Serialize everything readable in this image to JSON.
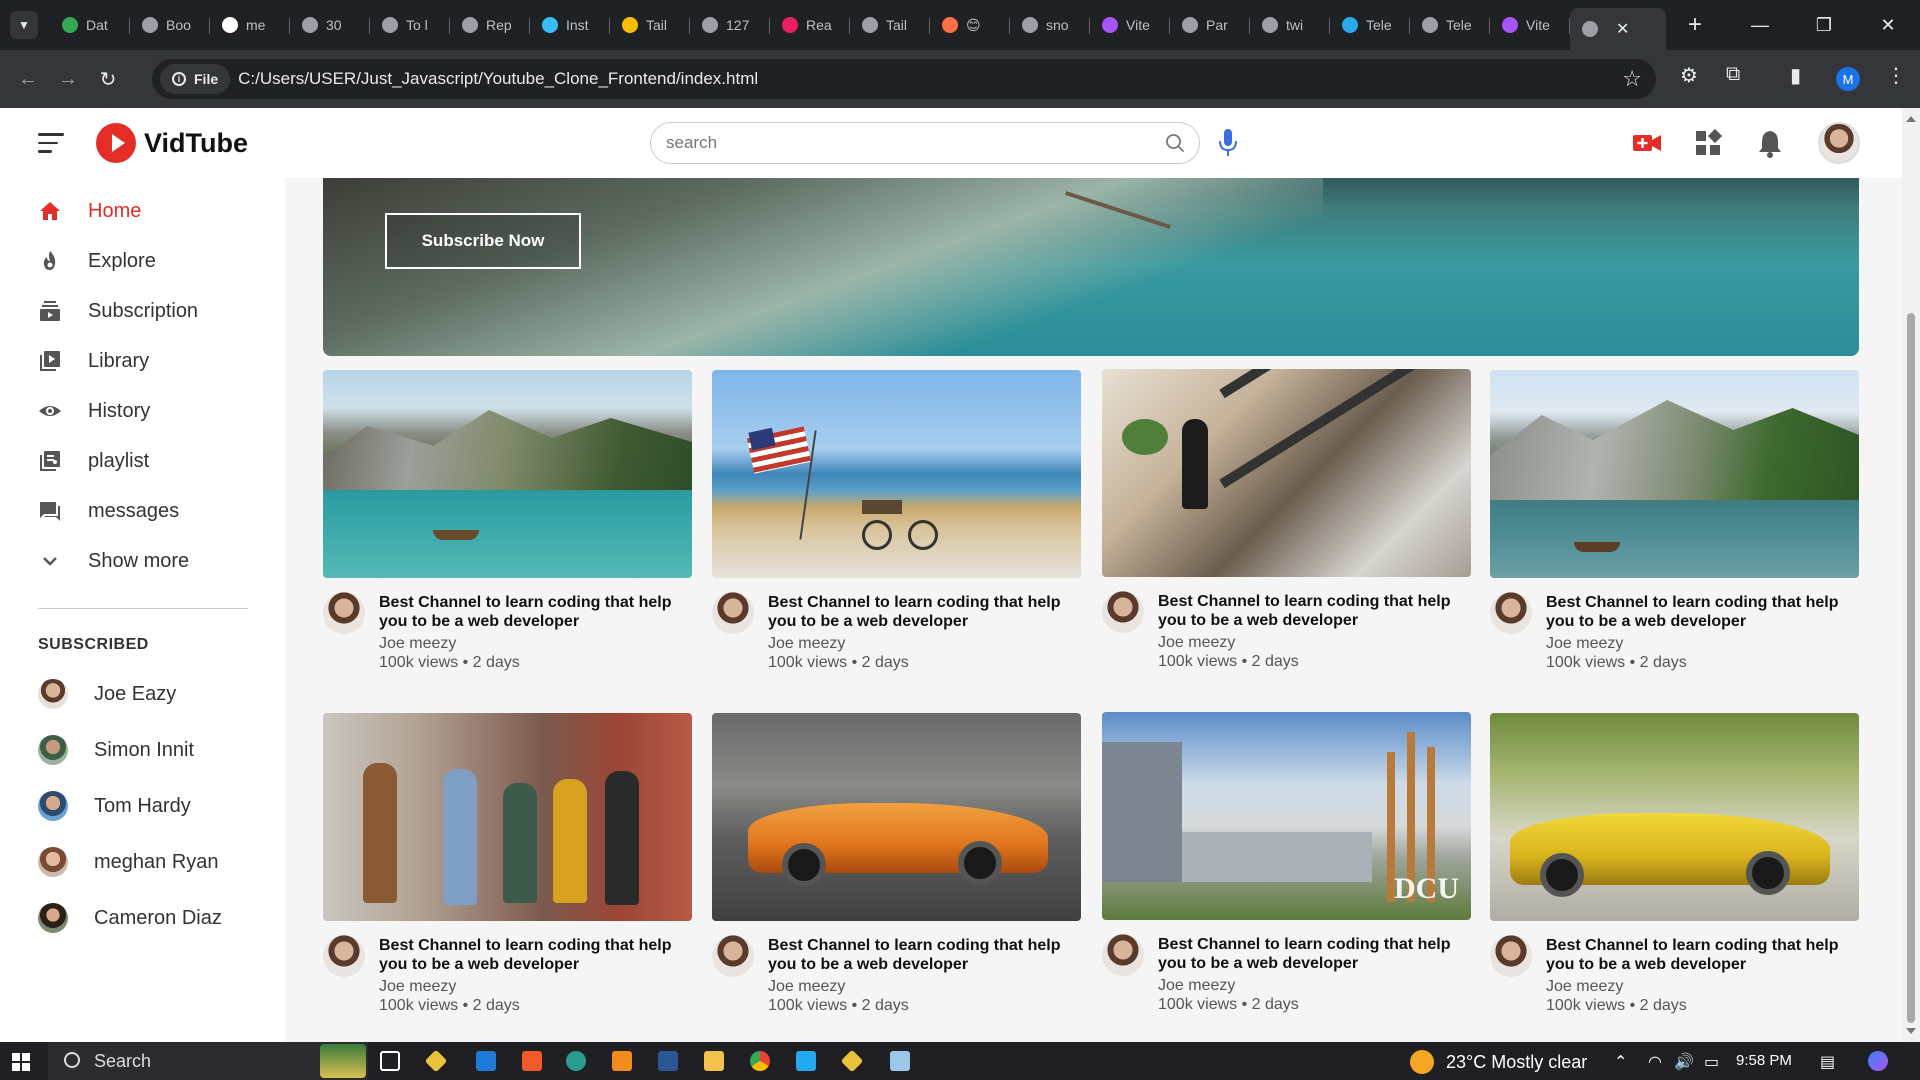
{
  "browser": {
    "tabs": [
      {
        "title": "Dat",
        "color": "#34a853"
      },
      {
        "title": "Boo",
        "color": "#9aa0a6"
      },
      {
        "title": "me",
        "color": "#ffffff"
      },
      {
        "title": "30",
        "color": "#9aa0a6"
      },
      {
        "title": "To l",
        "color": "#9aa0a6"
      },
      {
        "title": "Rep",
        "color": "#9aa0a6"
      },
      {
        "title": "Inst",
        "color": "#38bdf8"
      },
      {
        "title": "Tail",
        "color": "#fbbc04"
      },
      {
        "title": "127",
        "color": "#9aa0a6"
      },
      {
        "title": "Rea",
        "color": "#e91e63"
      },
      {
        "title": "Tail",
        "color": "#9aa0a6"
      },
      {
        "title": "😊",
        "color": "#ff7043"
      },
      {
        "title": "sno",
        "color": "#9aa0a6"
      },
      {
        "title": "Vite",
        "color": "#a855f7"
      },
      {
        "title": "Par",
        "color": "#9aa0a6"
      },
      {
        "title": "twi",
        "color": "#9aa0a6"
      },
      {
        "title": "Tele",
        "color": "#29a9ea"
      },
      {
        "title": "Tele",
        "color": "#9aa0a6"
      },
      {
        "title": "Vite",
        "color": "#a855f7"
      }
    ],
    "active_tab_icon": "globe-icon",
    "site_chip": "File",
    "url": "C:/Users/USER/Just_Javascript/Youtube_Clone_Frontend/index.html",
    "profile_initial": "M"
  },
  "header": {
    "logo_text": "VidTube",
    "search_placeholder": "search",
    "icons": [
      "menu-icon",
      "search-icon",
      "mic-icon",
      "video-camera-icon",
      "apps-icon",
      "bell-icon",
      "avatar"
    ]
  },
  "sidebar": {
    "nav": [
      {
        "label": "Home",
        "icon": "home-icon",
        "active": true
      },
      {
        "label": "Explore",
        "icon": "fire-icon",
        "active": false
      },
      {
        "label": "Subscription",
        "icon": "subscription-icon",
        "active": false
      },
      {
        "label": "Library",
        "icon": "library-icon",
        "active": false
      },
      {
        "label": "History",
        "icon": "eye-icon",
        "active": false
      },
      {
        "label": "playlist",
        "icon": "playlist-icon",
        "active": false
      },
      {
        "label": "messages",
        "icon": "messages-icon",
        "active": false
      },
      {
        "label": "Show more",
        "icon": "chevron-down-icon",
        "active": false
      }
    ],
    "subscribed_heading": "SUBSCRIBED",
    "subscribed": [
      {
        "name": "Joe Eazy"
      },
      {
        "name": "Simon Innit"
      },
      {
        "name": "Tom Hardy"
      },
      {
        "name": "meghan Ryan"
      },
      {
        "name": "Cameron Diaz"
      }
    ]
  },
  "banner": {
    "button_label": "Subscribe Now"
  },
  "videos": [
    {
      "title": "Best Channel to learn coding that help you to be a web developer",
      "channel": "Joe meezy",
      "meta": "100k views • 2 days",
      "thumb": "lake"
    },
    {
      "title": "Best Channel to learn coding that help you to be a web developer",
      "channel": "Joe meezy",
      "meta": "100k views • 2 days",
      "thumb": "beach"
    },
    {
      "title": "Best Channel to learn coding that help you to be a web developer",
      "channel": "Joe meezy",
      "meta": "100k views • 2 days",
      "thumb": "mall"
    },
    {
      "title": "Best Channel to learn coding that help you to be a web developer",
      "channel": "Joe meezy",
      "meta": "100k views • 2 days",
      "thumb": "lake2"
    },
    {
      "title": "Best Channel to learn coding that help you to be a web developer",
      "channel": "Joe meezy",
      "meta": "100k views • 2 days",
      "thumb": "street"
    },
    {
      "title": "Best Channel to learn coding that help you to be a web developer",
      "channel": "Joe meezy",
      "meta": "100k views • 2 days",
      "thumb": "car-orange"
    },
    {
      "title": "Best Channel to learn coding that help you to be a web developer",
      "channel": "Joe meezy",
      "meta": "100k views • 2 days",
      "thumb": "dcu"
    },
    {
      "title": "Best Channel to learn coding that help you to be a web developer",
      "channel": "Joe meezy",
      "meta": "100k views • 2 days",
      "thumb": "car-yellow"
    }
  ],
  "dcu_sign": "DCU",
  "taskbar": {
    "search_label": "Search",
    "weather": "23°C  Mostly clear",
    "weather_badge": "1",
    "time": "9:58 PM"
  },
  "colors": {
    "brand_red": "#e52d27",
    "browser_dark": "#202124",
    "browser_toolbar": "#35363a"
  }
}
